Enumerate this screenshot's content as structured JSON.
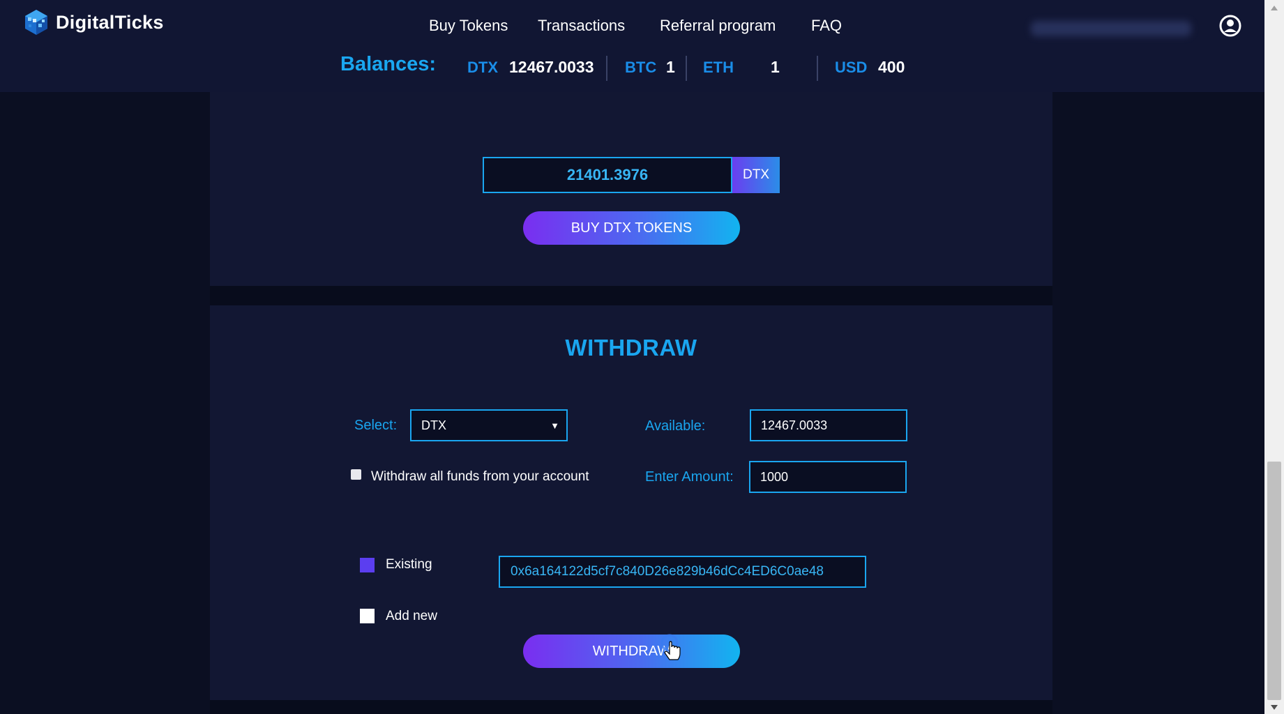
{
  "app": {
    "brand": "DigitalTicks"
  },
  "nav": {
    "items": [
      "Buy Tokens",
      "Transactions",
      "Referral program",
      "FAQ"
    ]
  },
  "balances": {
    "label": "Balances:",
    "items": [
      {
        "currency": "DTX",
        "value": "12467.0033"
      },
      {
        "currency": "BTC",
        "value": "1"
      },
      {
        "currency": "ETH",
        "value": "1"
      },
      {
        "currency": "USD",
        "value": "400"
      }
    ]
  },
  "buy": {
    "amount": "21401.3976",
    "unit": "DTX",
    "button_label": "BUY DTX TOKENS"
  },
  "withdraw": {
    "title": "WITHDRAW",
    "select_label": "Select:",
    "select_value": "DTX",
    "available_label": "Available:",
    "available_value": "12467.0033",
    "withdraw_all_label": "Withdraw all funds from your account",
    "amount_label": "Enter Amount:",
    "amount_value": "1000",
    "existing_label": "Existing",
    "add_new_label": "Add new",
    "address": "0x6a164122d5cf7c840D26e829b46dCc4ED6C0ae48",
    "button_label": "WITHDRAW"
  },
  "icons": {
    "user": "user-circle-icon",
    "logo": "logo-cube-icon",
    "select_arrow": "caret-down-icon",
    "cursor": "hand-pointer-icon"
  },
  "colors": {
    "accent": "#1aa6f0",
    "header_bg": "#111633",
    "panel_bg": "#121733",
    "page_bg": "#080c1c",
    "gradient_start": "#7a2ef0",
    "gradient_end": "#12b4f0",
    "existing_selected": "#5b3ef0"
  }
}
